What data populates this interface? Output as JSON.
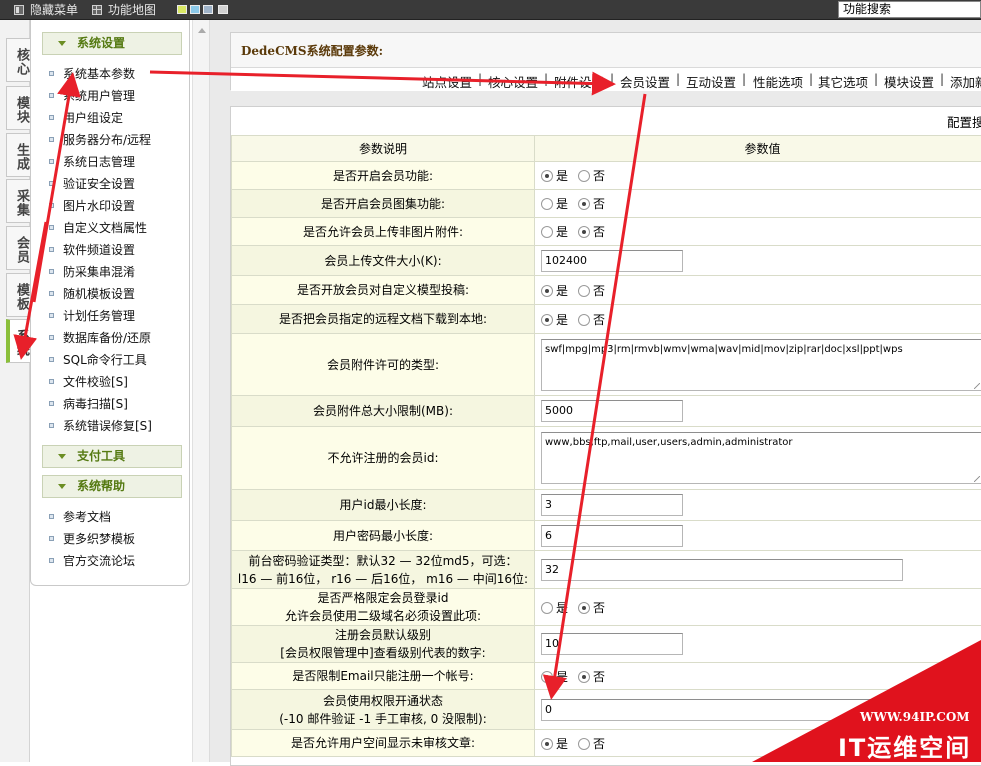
{
  "topbar": {
    "hide_menu": "隐藏菜单",
    "function_map": "功能地图",
    "skins": [
      "#d9e865",
      "#8cc9e8",
      "#9fb3c8",
      "#d0d0d0"
    ],
    "search_value": "功能搜索"
  },
  "left_tabs": [
    {
      "label": "核心"
    },
    {
      "label": "模块"
    },
    {
      "label": "生成"
    },
    {
      "label": "采集"
    },
    {
      "label": "会员"
    },
    {
      "label": "模板"
    },
    {
      "label": "系统",
      "active": true
    }
  ],
  "menu": {
    "system_settings": {
      "header": "系统设置",
      "items": [
        "系统基本参数",
        "系统用户管理",
        "用户组设定",
        "服务器分布/远程",
        "系统日志管理",
        "验证安全设置",
        "图片水印设置",
        "自定义文档属性",
        "软件频道设置",
        "防采集串混淆",
        "随机模板设置",
        "计划任务管理",
        "数据库备份/还原",
        "SQL命令行工具",
        "文件校验[S]",
        "病毒扫描[S]",
        "系统错误修复[S]"
      ]
    },
    "payment_tools": {
      "header": "支付工具"
    },
    "system_help": {
      "header": "系统帮助",
      "items": [
        "参考文档",
        "更多织梦模板",
        "官方交流论坛"
      ]
    }
  },
  "config": {
    "title": "DedeCMS系统配置参数:",
    "tabs": [
      "站点设置",
      "核心设置",
      "附件设置",
      "会员设置",
      "互动设置",
      "性能选项",
      "其它选项",
      "模块设置",
      "添加新"
    ],
    "search_label": "配置搜",
    "header_key": "参数说明",
    "header_value": "参数值",
    "yes": "是",
    "no": "否",
    "rows": [
      {
        "label": "是否开启会员功能:",
        "type": "radio",
        "selected": "是"
      },
      {
        "label": "是否开启会员图集功能:",
        "type": "radio",
        "selected": "否"
      },
      {
        "label": "是否允许会员上传非图片附件:",
        "type": "radio",
        "selected": "否"
      },
      {
        "label": "会员上传文件大小(K):",
        "type": "text",
        "value": "102400"
      },
      {
        "label": "是否开放会员对自定义模型投稿:",
        "type": "radio",
        "selected": "是"
      },
      {
        "label": "是否把会员指定的远程文档下载到本地:",
        "type": "radio",
        "selected": "是"
      },
      {
        "label": "会员附件许可的类型:",
        "type": "textarea",
        "value": "swf|mpg|mp3|rm|rmvb|wmv|wma|wav|mid|mov|zip|rar|doc|xsl|ppt|wps"
      },
      {
        "label": "会员附件总大小限制(MB):",
        "type": "text",
        "value": "5000"
      },
      {
        "label": "不允许注册的会员id:",
        "type": "textarea",
        "value": "www,bbs,ftp,mail,user,users,admin,administrator"
      },
      {
        "label": "用户id最小长度:",
        "type": "text",
        "value": "3"
      },
      {
        "label": "用户密码最小长度:",
        "type": "text",
        "value": "6"
      },
      {
        "label": "前台密码验证类型：默认32 — 32位md5，可选：",
        "label2": "l16 — 前16位， r16 — 后16位， m16 — 中间16位:",
        "type": "text",
        "value": "32",
        "wide": true
      },
      {
        "label": "是否严格限定会员登录id",
        "label2": "允许会员使用二级域名必须设置此项:",
        "type": "radio",
        "selected": "否"
      },
      {
        "label": "注册会员默认级别",
        "label2": "[会员权限管理中]查看级别代表的数字:",
        "type": "text",
        "value": "10"
      },
      {
        "label": "是否限制Email只能注册一个帐号:",
        "type": "radio",
        "selected": "否"
      },
      {
        "label": "会员使用权限开通状态",
        "label2": "(-10 邮件验证 -1 手工审核, 0 没限制):",
        "type": "text",
        "value": "0",
        "wide": true
      },
      {
        "label": "是否允许用户空间显示未审核文章:",
        "type": "radio",
        "selected": "是"
      }
    ]
  },
  "watermark": {
    "url": "WWW.94IP.COM",
    "text": "IT运维空间",
    "color": "#e0121d"
  },
  "annotation_color": "#e8202a"
}
